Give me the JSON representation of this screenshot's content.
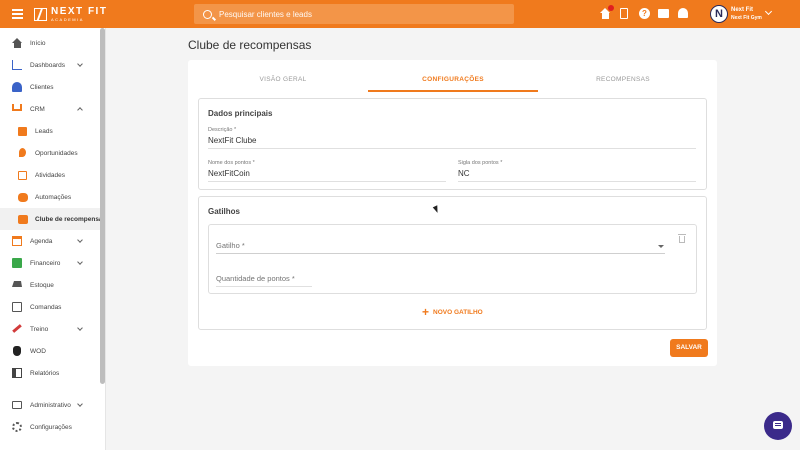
{
  "header": {
    "logo_title": "NEXT FIT",
    "logo_subtitle": "ACADEMIA",
    "search_placeholder": "Pesquisar clientes e leads",
    "user_name": "Next Fit",
    "user_gym": "Next Fit Gym",
    "avatar_letter": "N",
    "help_glyph": "?"
  },
  "sidebar": {
    "items": [
      {
        "label": "Início",
        "icon": "home-icon"
      },
      {
        "label": "Dashboards",
        "icon": "chart-icon"
      },
      {
        "label": "Clientes",
        "icon": "users-icon"
      },
      {
        "label": "CRM",
        "icon": "crm-icon"
      },
      {
        "label": "Leads",
        "icon": "leads-icon"
      },
      {
        "label": "Oportunidades",
        "icon": "opportunity-icon"
      },
      {
        "label": "Atividades",
        "icon": "activities-icon"
      },
      {
        "label": "Automações",
        "icon": "automation-icon"
      },
      {
        "label": "Clube de recompensa",
        "icon": "rewards-icon"
      },
      {
        "label": "Agenda",
        "icon": "calendar-icon"
      },
      {
        "label": "Financeiro",
        "icon": "money-icon"
      },
      {
        "label": "Estoque",
        "icon": "cart-icon"
      },
      {
        "label": "Comandas",
        "icon": "orders-icon"
      },
      {
        "label": "Treino",
        "icon": "training-icon"
      },
      {
        "label": "WOD",
        "icon": "wod-icon"
      },
      {
        "label": "Relatórios",
        "icon": "reports-icon"
      },
      {
        "label": "Administrativo",
        "icon": "admin-icon"
      },
      {
        "label": "Configurações",
        "icon": "gear-icon"
      }
    ]
  },
  "main": {
    "page_title": "Clube de recompensas",
    "tabs": [
      {
        "label": "VISÃO GERAL"
      },
      {
        "label": "CONFIGURAÇÕES"
      },
      {
        "label": "RECOMPENSAS"
      }
    ],
    "dados": {
      "title": "Dados principais",
      "descricao_label": "Descrição *",
      "descricao_value": "NextFit Clube",
      "nome_pontos_label": "Nome dos pontos *",
      "nome_pontos_value": "NextFitCoin",
      "sigla_label": "Sigla dos pontos *",
      "sigla_value": "NC"
    },
    "gatilhos": {
      "title": "Gatilhos",
      "gatilho_placeholder": "Gatilho *",
      "quantidade_placeholder": "Quantidade de pontos *",
      "add_label": "NOVO GATILHO",
      "add_glyph": "+"
    },
    "save_label": "SALVAR"
  },
  "colors": {
    "brand": "#f07a1d",
    "fab": "#3b2a8a"
  }
}
